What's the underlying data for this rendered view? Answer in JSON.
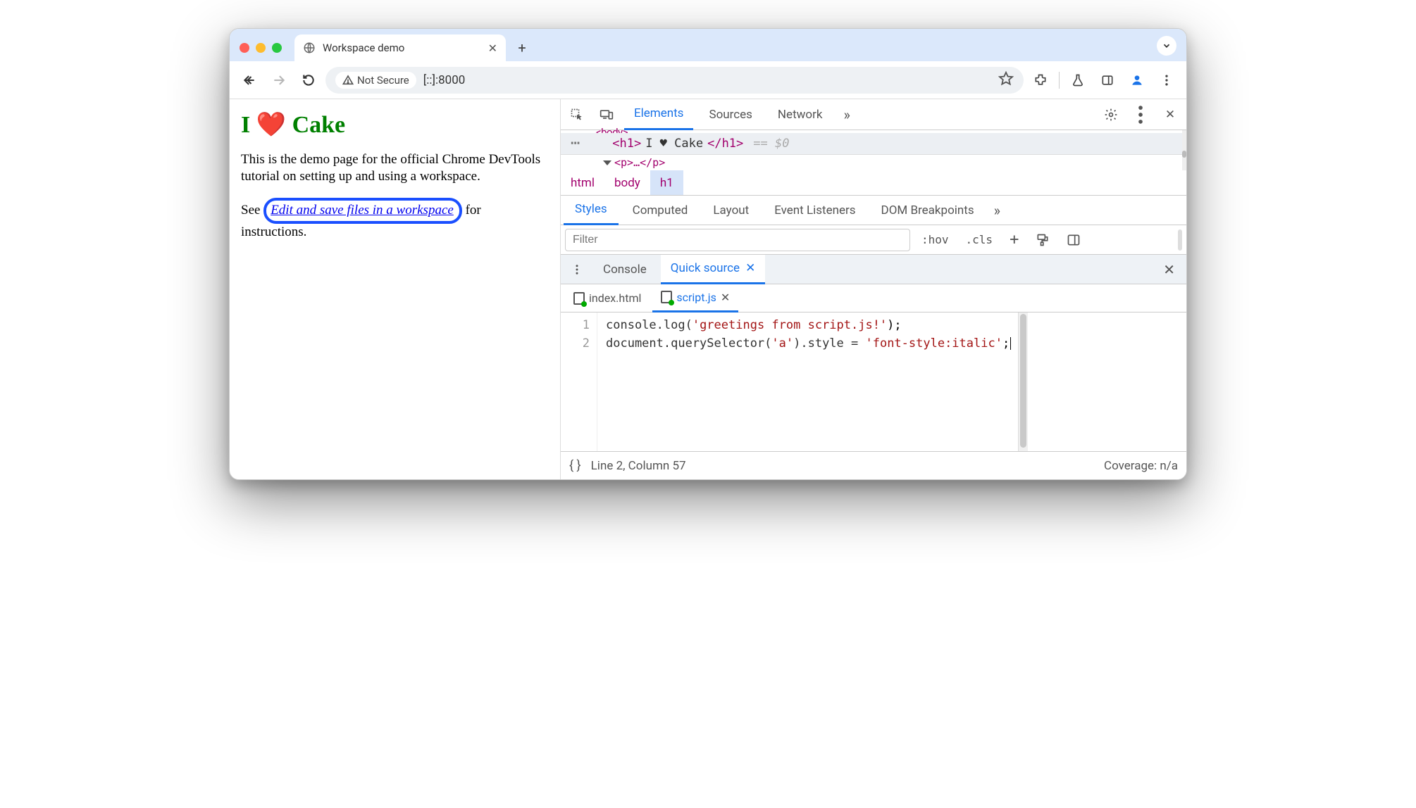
{
  "window": {
    "tab_title": "Workspace demo"
  },
  "addressbar": {
    "security_label": "Not Secure",
    "url": "[::]:8000"
  },
  "page": {
    "heading": "I ❤️ Cake",
    "para1": "This is the demo page for the official Chrome DevTools tutorial on setting up and using a workspace.",
    "p2_pre": "See ",
    "link": "Edit and save files in a workspace",
    "p2_post": " for instructions."
  },
  "devtools": {
    "tabs": [
      "Elements",
      "Sources",
      "Network"
    ],
    "active_tab": "Elements",
    "more_glyph": "»",
    "dom": {
      "prev_line": "<body>",
      "open_tag": "<h1>",
      "text": "I ♥ Cake",
      "close_tag": "</h1>",
      "selector_hint": "== $0",
      "next_line": "<p>…</p>"
    },
    "breadcrumb": [
      "html",
      "body",
      "h1"
    ],
    "styles_tabs": [
      "Styles",
      "Computed",
      "Layout",
      "Event Listeners",
      "DOM Breakpoints"
    ],
    "filter_placeholder": "Filter",
    "tools": {
      "hov": ":hov",
      "cls": ".cls"
    },
    "drawer_tabs": [
      "Console",
      "Quick source"
    ],
    "drawer_active": "Quick source",
    "file_tabs": [
      "index.html",
      "script.js"
    ],
    "file_active": "script.js",
    "code": {
      "line_numbers": [
        "1",
        "2"
      ],
      "l1_pre": "console.log(",
      "l1_str": "'greetings from script.js!'",
      "l1_post": ");",
      "l2_pre": "document.querySelector(",
      "l2_arg": "'a'",
      "l2_mid": ").style = ",
      "l2_str": "'font-style:italic'",
      "l2_post": ";"
    },
    "status": {
      "format_glyph": "{ }",
      "cursor": "Line 2, Column 57",
      "coverage": "Coverage: n/a"
    }
  }
}
